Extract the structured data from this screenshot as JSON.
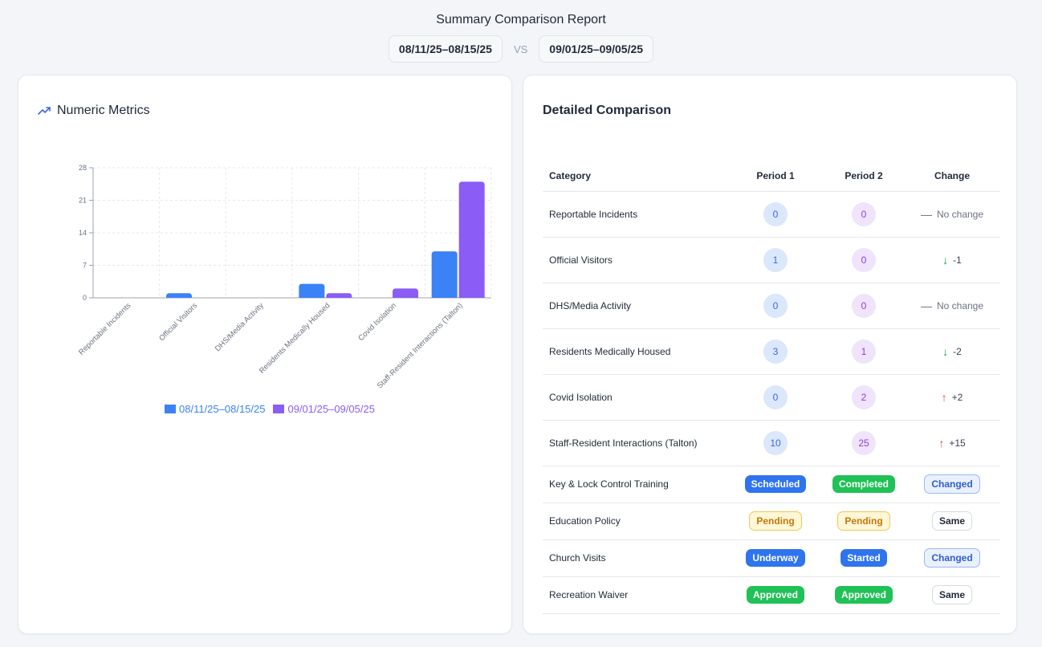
{
  "report": {
    "title": "Summary Comparison Report",
    "period1": "08/11/25–08/15/25",
    "vs": "VS",
    "period2": "09/01/25–09/05/25"
  },
  "numeric_card": {
    "title": "Numeric Metrics",
    "icon": "trending-up-icon"
  },
  "chart_data": {
    "type": "bar",
    "categories": [
      "Reportable Incidents",
      "Official Visitors",
      "DHS/Media Activity",
      "Residents Medically Housed",
      "Covid Isolation",
      "Staff-Resident Interactions (Talton)"
    ],
    "series": [
      {
        "name": "08/11/25–08/15/25",
        "values": [
          0,
          1,
          0,
          3,
          0,
          10
        ],
        "color": "#3b82f6"
      },
      {
        "name": "09/01/25–09/05/25",
        "values": [
          0,
          0,
          0,
          1,
          2,
          25
        ],
        "color": "#8b5cf6"
      }
    ],
    "yticks": [
      "0",
      "7",
      "14",
      "21",
      "28"
    ],
    "ylim": [
      0,
      28
    ],
    "grid": true,
    "legend_placement": "bottom"
  },
  "detail_card": {
    "title": "Detailed Comparison",
    "headers": {
      "category": "Category",
      "period1": "Period 1",
      "period2": "Period 2",
      "change": "Change"
    },
    "numeric_rows": [
      {
        "category": "Reportable Incidents",
        "p1": "0",
        "p2": "0",
        "change_symbol": "—",
        "change_text": "No change",
        "trend": "neutral"
      },
      {
        "category": "Official Visitors",
        "p1": "1",
        "p2": "0",
        "change_symbol": "↓",
        "change_text": "-1",
        "trend": "down"
      },
      {
        "category": "DHS/Media Activity",
        "p1": "0",
        "p2": "0",
        "change_symbol": "—",
        "change_text": "No change",
        "trend": "neutral"
      },
      {
        "category": "Residents Medically Housed",
        "p1": "3",
        "p2": "1",
        "change_symbol": "↓",
        "change_text": "-2",
        "trend": "down"
      },
      {
        "category": "Covid Isolation",
        "p1": "0",
        "p2": "2",
        "change_symbol": "↑",
        "change_text": "+2",
        "trend": "up"
      },
      {
        "category": "Staff-Resident Interactions (Talton)",
        "p1": "10",
        "p2": "25",
        "change_symbol": "↑",
        "change_text": "+15",
        "trend": "up"
      }
    ],
    "status_rows": [
      {
        "category": "Key & Lock Control Training",
        "p1": "Scheduled",
        "p2": "Completed",
        "change": "Changed"
      },
      {
        "category": "Education Policy",
        "p1": "Pending",
        "p2": "Pending",
        "change": "Same"
      },
      {
        "category": "Church Visits",
        "p1": "Underway",
        "p2": "Started",
        "change": "Changed"
      },
      {
        "category": "Recreation Waiver",
        "p1": "Approved",
        "p2": "Approved",
        "change": "Same"
      }
    ]
  }
}
